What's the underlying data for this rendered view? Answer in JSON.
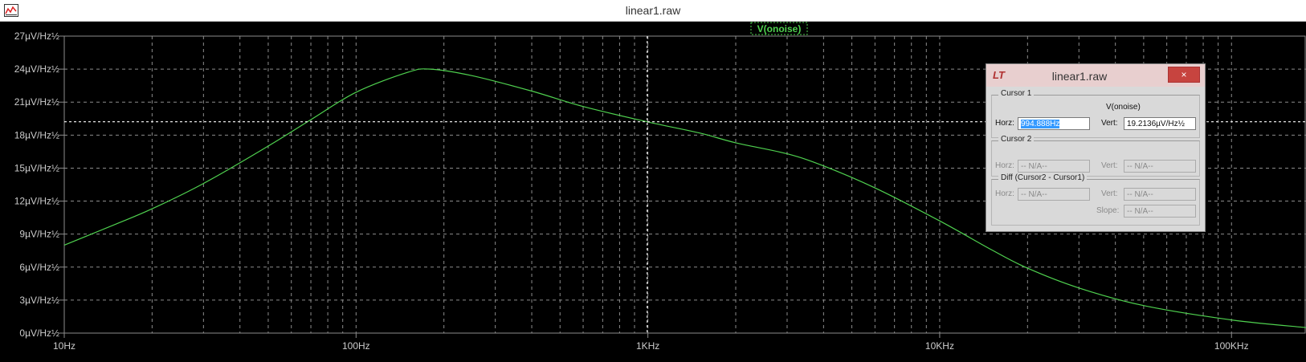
{
  "window": {
    "title": "linear1.raw",
    "app_icon": "waveform-icon"
  },
  "colors": {
    "background": "#000000",
    "grid": "#8c8c8c",
    "trace": "#4fd14f",
    "axis_text": "#cccccc",
    "cursor": "#ffffff"
  },
  "chart_data": {
    "type": "line",
    "x_scale": "log",
    "xlim": [
      10,
      180000
    ],
    "ylim": [
      0,
      27
    ],
    "x_ticks": [
      "10Hz",
      "100Hz",
      "1KHz",
      "10KHz",
      "100KHz"
    ],
    "y_ticks": [
      "0µV/Hz½",
      "3µV/Hz½",
      "6µV/Hz½",
      "9µV/Hz½",
      "12µV/Hz½",
      "15µV/Hz½",
      "18µV/Hz½",
      "21µV/Hz½",
      "24µV/Hz½",
      "27µV/Hz½"
    ],
    "grid": true,
    "series": [
      {
        "name": "V(onoise)",
        "x": [
          10,
          15,
          20,
          30,
          50,
          70,
          100,
          150,
          180,
          250,
          400,
          600,
          1000,
          1500,
          2000,
          3000,
          4000,
          6000,
          10000,
          15000,
          20000,
          30000,
          50000,
          100000,
          180000
        ],
        "y": [
          8.0,
          9.9,
          11.3,
          13.6,
          17.0,
          19.4,
          21.9,
          23.7,
          24.0,
          23.4,
          22.0,
          20.6,
          19.2,
          18.2,
          17.3,
          16.3,
          15.2,
          13.2,
          10.2,
          7.6,
          5.9,
          4.1,
          2.5,
          1.2,
          0.5
        ]
      }
    ],
    "cursor": {
      "x": 994.888,
      "y": 19.2136
    }
  },
  "dialog": {
    "title": "linear1.raw",
    "close_label": "×",
    "cursor1_label": "Cursor 1",
    "trace_name": "V(onoise)",
    "horz_label": "Horz:",
    "vert_label": "Vert:",
    "horz_value": "994.888Hz",
    "vert_value": "19.2136µV/Hz½",
    "cursor2_label": "Cursor 2",
    "c2_horz_label": "Horz:",
    "c2_vert_label": "Vert:",
    "c2_horz_value": "-- N/A--",
    "c2_vert_value": "-- N/A--",
    "diff_label": "Diff (Cursor2 - Cursor1)",
    "d_horz_label": "Horz:",
    "d_vert_label": "Vert:",
    "d_slope_label": "Slope:",
    "d_horz_value": "-- N/A--",
    "d_vert_value": "-- N/A--",
    "d_slope_value": "-- N/A--"
  }
}
